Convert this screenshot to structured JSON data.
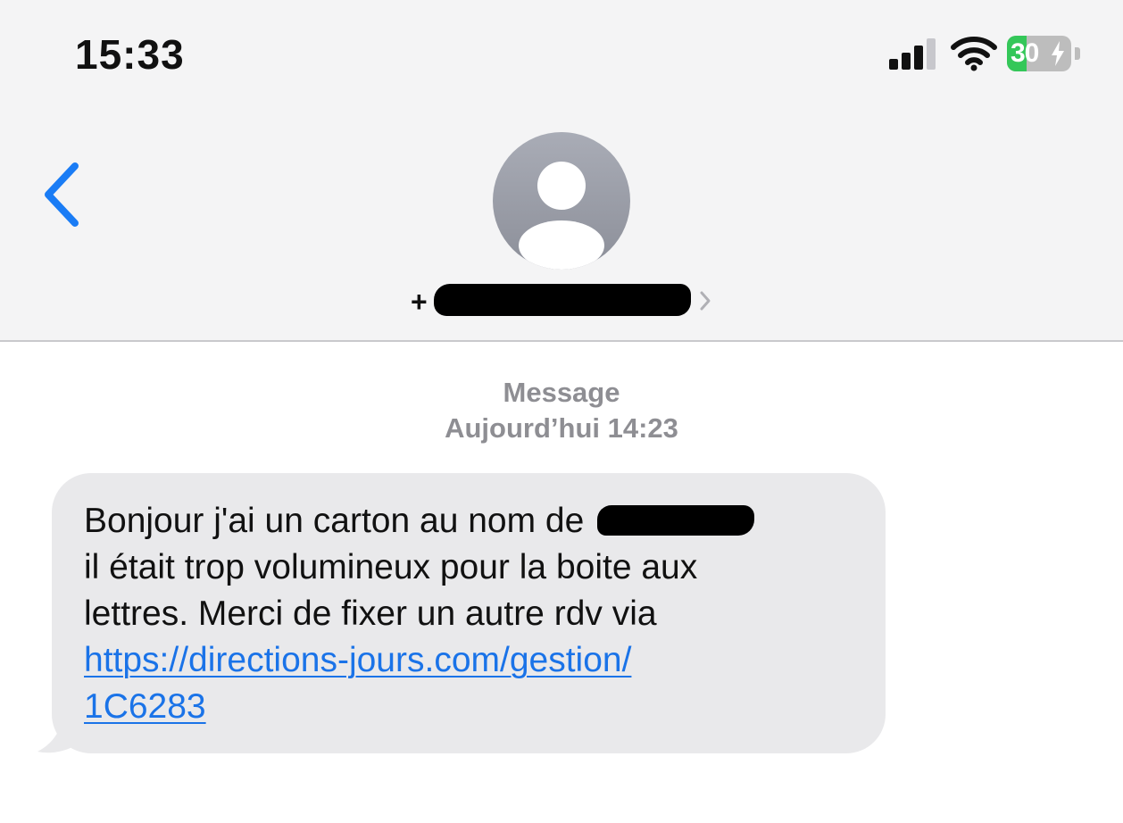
{
  "status_bar": {
    "time": "15:33",
    "battery_level": "30",
    "battery_charging": true,
    "signal_bars_active": 3,
    "signal_bars_total": 4,
    "icons": [
      "cellular-signal-icon",
      "wifi-icon",
      "battery-icon"
    ],
    "battery_color": "#34c759"
  },
  "header": {
    "back_icon": "chevron-left-icon",
    "avatar_icon": "person-placeholder-icon",
    "contact_prefix": "+",
    "contact_redacted": true,
    "contact_chevron_icon": "chevron-right-icon"
  },
  "conversation": {
    "service_label": "Message",
    "timestamp": "Aujourd’hui 14:23",
    "message": {
      "line1": "Bonjour j'ai un carton au nom de",
      "line2": "il était trop volumineux pour la boite aux",
      "line3": "lettres. Merci de fixer un autre rdv via",
      "link_line1": "https://directions-jours.com/gestion/",
      "link_line2": "1C6283"
    }
  },
  "colors": {
    "accent": "#1a73e8",
    "back_button": "#1a7cf5",
    "bubble": "#e9e9eb",
    "header_bg": "#f4f4f5",
    "meta_text": "#8e8e93"
  }
}
